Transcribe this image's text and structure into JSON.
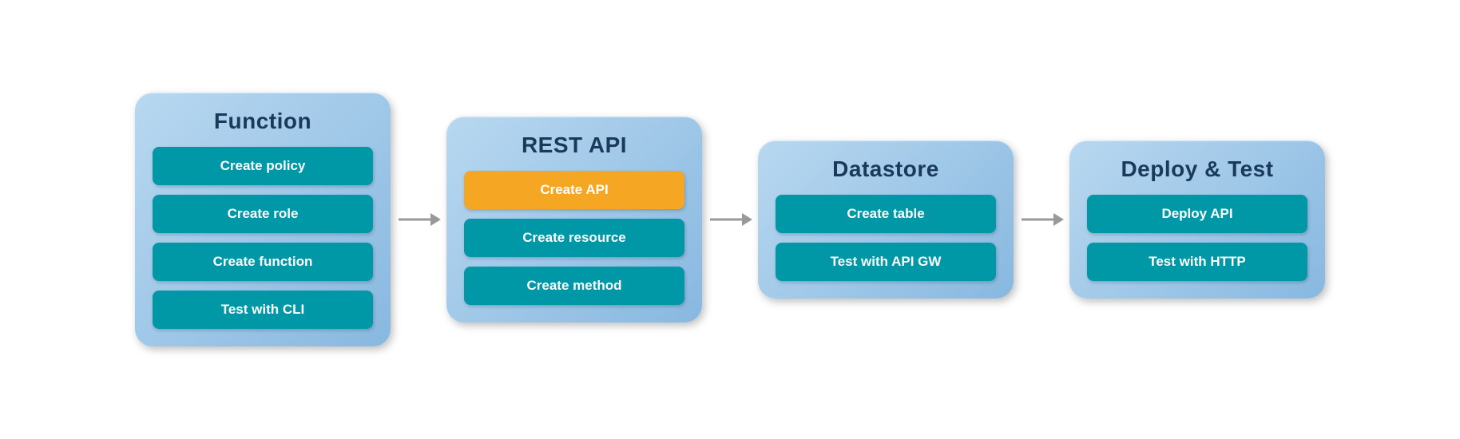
{
  "panels": [
    {
      "id": "function",
      "title": "Function",
      "buttons": [
        {
          "id": "create-policy",
          "label": "Create policy",
          "active": false
        },
        {
          "id": "create-role",
          "label": "Create role",
          "active": false
        },
        {
          "id": "create-function",
          "label": "Create function",
          "active": false
        },
        {
          "id": "test-with-cli",
          "label": "Test with CLI",
          "active": false
        }
      ]
    },
    {
      "id": "rest-api",
      "title": "REST API",
      "buttons": [
        {
          "id": "create-api",
          "label": "Create API",
          "active": true
        },
        {
          "id": "create-resource",
          "label": "Create resource",
          "active": false
        },
        {
          "id": "create-method",
          "label": "Create method",
          "active": false
        }
      ]
    },
    {
      "id": "datastore",
      "title": "Datastore",
      "buttons": [
        {
          "id": "create-table",
          "label": "Create table",
          "active": false
        },
        {
          "id": "test-with-api-gw",
          "label": "Test with API GW",
          "active": false
        }
      ]
    },
    {
      "id": "deploy-test",
      "title": "Deploy & Test",
      "buttons": [
        {
          "id": "deploy-api",
          "label": "Deploy API",
          "active": false
        },
        {
          "id": "test-with-http",
          "label": "Test with HTTP",
          "active": false
        }
      ]
    }
  ],
  "arrow": {
    "color": "#999"
  }
}
